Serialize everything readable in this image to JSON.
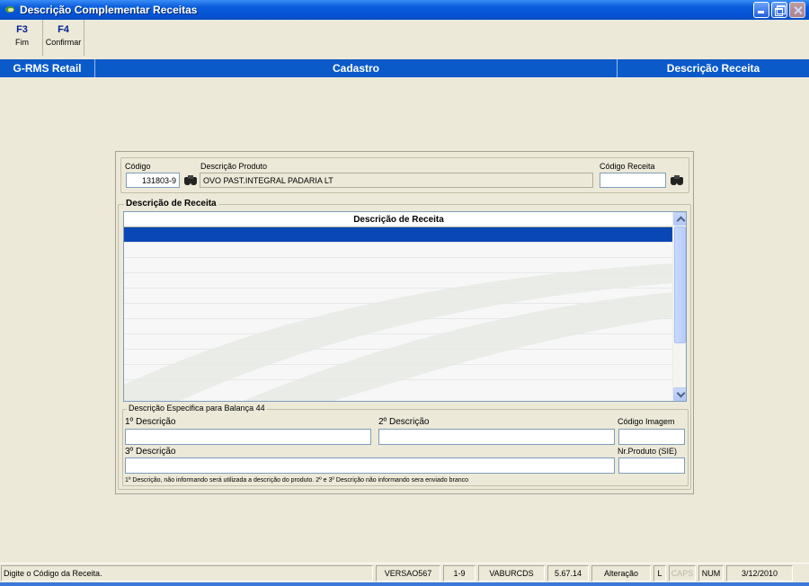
{
  "window": {
    "title": "Descrição Complementar Receitas",
    "title_bar_color": "#0a5ddc"
  },
  "toolbar": {
    "buttons": [
      {
        "key": "F3",
        "label": "Fim"
      },
      {
        "key": "F4",
        "label": "Confirmar"
      }
    ]
  },
  "header_band": {
    "left": "G-RMS Retail",
    "center": "Cadastro",
    "right": "Descrição Receita",
    "color": "#0a5ac9"
  },
  "form": {
    "codigo_label": "Código",
    "codigo_value": "131803-9",
    "descricao_produto_label": "Descrição Produto",
    "descricao_produto_value": "OVO PAST.INTEGRAL PADARIA LT",
    "codigo_receita_label": "Código Receita",
    "codigo_receita_value": "",
    "search_icon": "binoculars-icon"
  },
  "receita_group": {
    "legend": "Descrição de Receita",
    "grid_header": "Descrição de Receita",
    "selected_row_color": "#0a47b6"
  },
  "balanca_group": {
    "legend": "Descrição Especifica para Balança 44",
    "desc1_label": "1º Descrição",
    "desc1_value": "",
    "desc2_label": "2º Descrição",
    "desc2_value": "",
    "codigo_imagem_label": "Código Imagem",
    "codigo_imagem_value": "",
    "desc3_label": "3º Descrição",
    "desc3_value": "",
    "nr_produto_label": "Nr.Produto (SIE)",
    "nr_produto_value": "",
    "footnote": "1º Descrição, não informando será utilizada a descrição do produto. 2º e 3º Descrição não informando sera enviado branco"
  },
  "statusbar": {
    "message": "Digite o Código da Receita.",
    "version": "VERSAO567",
    "page": "1-9",
    "user": "VABURCDS",
    "build": "5.67.14",
    "mode": "Alteração",
    "lock": "L",
    "caps": "CAPS",
    "num": "NUM",
    "date": "3/12/2010"
  }
}
